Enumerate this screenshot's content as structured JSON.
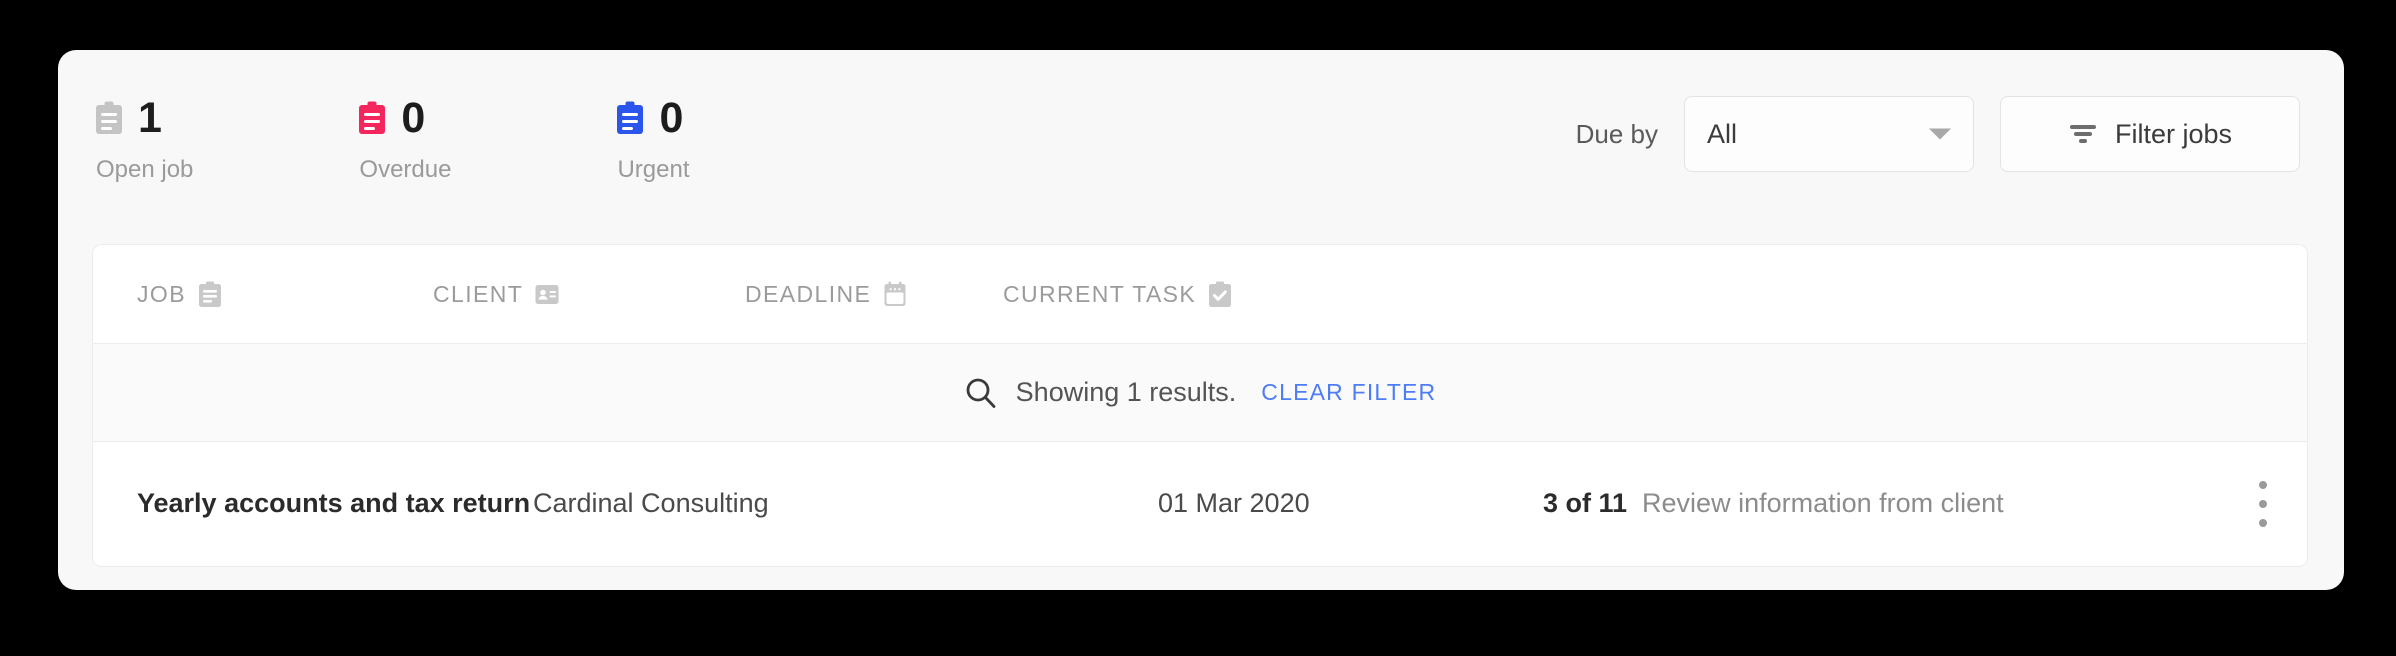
{
  "summary": {
    "stats": [
      {
        "icon": "clipboard-icon",
        "value": "1",
        "label": "Open job",
        "color": "#c4c4c4"
      },
      {
        "icon": "clipboard-icon",
        "value": "0",
        "label": "Overdue",
        "color": "#f5255e"
      },
      {
        "icon": "clipboard-icon",
        "value": "0",
        "label": "Urgent",
        "color": "#2c55ec"
      }
    ],
    "due_by_label": "Due by",
    "due_by_select": {
      "value": "All",
      "options": [
        "All"
      ],
      "caret_icon": "chevron-down-icon"
    },
    "filter_button": {
      "label": "Filter jobs",
      "icon": "filter-funnel-icon"
    }
  },
  "table": {
    "columns": [
      {
        "label": "JOB",
        "icon": "clipboard-icon"
      },
      {
        "label": "CLIENT",
        "icon": "contact-card-icon"
      },
      {
        "label": "DEADLINE",
        "icon": "calendar-icon"
      },
      {
        "label": "CURRENT TASK",
        "icon": "clipboard-check-icon"
      }
    ],
    "results_bar": {
      "icon": "search-icon",
      "text": "Showing 1 results.",
      "clear_filter_label": "CLEAR FILTER"
    },
    "rows": [
      {
        "job": "Yearly accounts and tax return",
        "client": "Cardinal Consulting",
        "deadline": "01 Mar 2020",
        "task_progress": "3 of 11",
        "task_name": "Review information from client",
        "menu_icon": "kebab-menu-icon"
      }
    ]
  },
  "colors": {
    "page_background": "#000000",
    "card_background": "#f8f8f8",
    "panel_background": "#ffffff",
    "results_band": "#fafafa",
    "link": "#4d7cf7",
    "overdue": "#f5255e",
    "urgent": "#2c55ec",
    "muted": "#9b9b9b"
  }
}
